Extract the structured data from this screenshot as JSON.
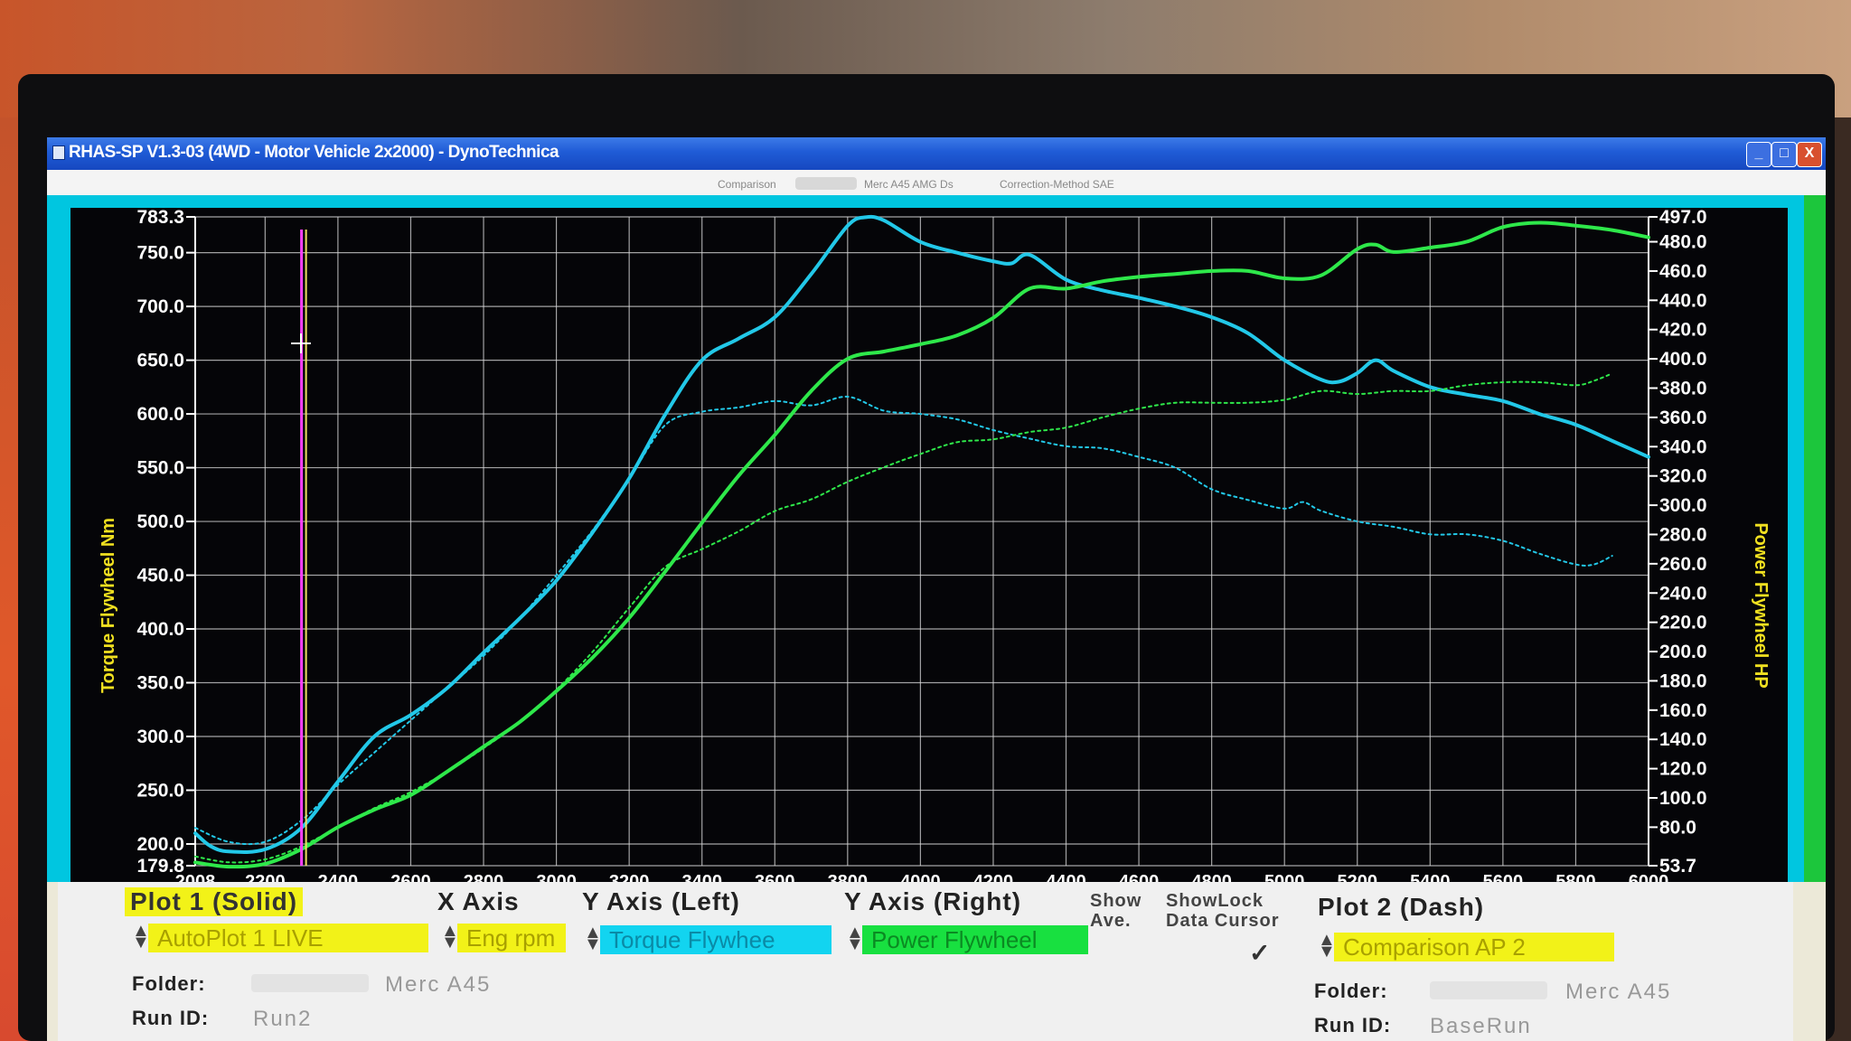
{
  "window": {
    "title": "RHAS-SP V1.3-03  (4WD - Motor Vehicle 2x2000) - DynoTechnica",
    "min": "_",
    "max": "□",
    "close": "X"
  },
  "comparison": {
    "label": "Comparison",
    "vehicle": "Merc A45 AMG Ds",
    "correction": "Correction-Method  SAE"
  },
  "panel": {
    "plot1_header": "Plot 1 (Solid)",
    "plot1_select": "AutoPlot 1 LIVE",
    "xaxis_header": "X Axis",
    "xaxis_select": "Eng rpm",
    "yleft_header": "Y Axis (Left)",
    "yleft_select": "Torque Flywhee",
    "yright_header": "Y Axis (Right)",
    "yright_select": "Power Flywheel",
    "show_ave_1": "Show",
    "show_ave_2": "Ave.",
    "showlock_1": "ShowLock",
    "showlock_2": "Data Cursor",
    "checkmark": "✓",
    "plot2_header": "Plot 2 (Dash)",
    "plot2_select": "Comparison AP 2",
    "folder_label": "Folder:",
    "folder1_value": "Merc A45",
    "runid_label": "Run ID:",
    "runid1_value": "Run2",
    "folder2_value": "Merc A45",
    "runid2_value": "BaseRun"
  },
  "colors": {
    "background": "#050508",
    "grid": "#d8d8d8",
    "torque": "#22c8e8",
    "power": "#2ee84a",
    "axis_label": "#f0e020",
    "cursor_magenta": "#ff40ff",
    "cursor_yellow": "#f0e060",
    "plot1_highlight": "#f2f218",
    "torque_highlight": "#12d4f0",
    "power_highlight": "#18e040"
  },
  "chart_data": {
    "type": "line",
    "xlabel": "",
    "ylabel_left": "Torque Flywheel Nm",
    "ylabel_right": "Power Flywheel HP",
    "xlim": [
      2008,
      6000
    ],
    "ylim_left": [
      179.8,
      783.3
    ],
    "ylim_right": [
      53.7,
      497.0
    ],
    "x_ticks": [
      "2008",
      "2200",
      "2400",
      "2600",
      "2800",
      "3000",
      "3200",
      "3400",
      "3600",
      "3800",
      "4000",
      "4200",
      "4400",
      "4600",
      "4800",
      "5000",
      "5200",
      "5400",
      "5600",
      "5800",
      "6000"
    ],
    "y_left_ticks": [
      179.8,
      200.0,
      250.0,
      300.0,
      350.0,
      400.0,
      450.0,
      500.0,
      550.0,
      600.0,
      650.0,
      700.0,
      750.0,
      783.3
    ],
    "y_right_ticks": [
      53.7,
      80.0,
      100.0,
      120.0,
      140.0,
      160.0,
      180.0,
      200.0,
      220.0,
      240.0,
      260.0,
      280.0,
      300.0,
      320.0,
      340.0,
      360.0,
      380.0,
      400.0,
      420.0,
      440.0,
      460.0,
      480.0,
      497.0
    ],
    "grid": true,
    "cursor_rpm": 2300,
    "series": [
      {
        "axis": "left",
        "style": "solid",
        "x": [
          2008,
          2050,
          2100,
          2200,
          2300,
          2400,
          2500,
          2600,
          2700,
          2800,
          2900,
          3000,
          3100,
          3200,
          3300,
          3400,
          3500,
          3600,
          3700,
          3800,
          3850,
          3900,
          4000,
          4100,
          4200,
          4250,
          4300,
          4400,
          4500,
          4600,
          4700,
          4800,
          4900,
          5000,
          5100,
          5150,
          5200,
          5250,
          5300,
          5400,
          5500,
          5600,
          5700,
          5800,
          5900,
          6000
        ],
        "y": [
          210,
          198,
          193,
          195,
          215,
          258,
          300,
          320,
          345,
          378,
          410,
          445,
          490,
          540,
          600,
          650,
          670,
          690,
          730,
          775,
          783,
          780,
          760,
          750,
          742,
          740,
          748,
          725,
          715,
          708,
          700,
          690,
          675,
          650,
          632,
          630,
          638,
          650,
          640,
          625,
          618,
          612,
          600,
          590,
          575,
          560
        ]
      },
      {
        "axis": "left",
        "style": "dash",
        "x": [
          2008,
          2100,
          2200,
          2300,
          2400,
          2500,
          2600,
          2700,
          2800,
          2900,
          3000,
          3100,
          3200,
          3300,
          3400,
          3500,
          3600,
          3700,
          3800,
          3900,
          4000,
          4100,
          4200,
          4300,
          4400,
          4500,
          4600,
          4700,
          4800,
          4900,
          5000,
          5050,
          5100,
          5200,
          5300,
          5400,
          5500,
          5600,
          5700,
          5800,
          5850,
          5900
        ],
        "y": [
          215,
          202,
          202,
          222,
          255,
          285,
          315,
          345,
          375,
          410,
          450,
          492,
          540,
          590,
          602,
          606,
          612,
          608,
          616,
          603,
          600,
          595,
          585,
          577,
          570,
          568,
          560,
          550,
          530,
          520,
          512,
          518,
          510,
          500,
          495,
          488,
          488,
          482,
          470,
          460,
          460,
          468
        ]
      },
      {
        "axis": "right",
        "style": "solid",
        "x": [
          2008,
          2100,
          2200,
          2300,
          2400,
          2500,
          2600,
          2700,
          2800,
          2900,
          3000,
          3100,
          3200,
          3300,
          3400,
          3500,
          3600,
          3700,
          3800,
          3900,
          4000,
          4100,
          4200,
          4300,
          4400,
          4500,
          4600,
          4700,
          4800,
          4900,
          5000,
          5100,
          5200,
          5250,
          5300,
          5400,
          5500,
          5600,
          5700,
          5800,
          5900,
          6000
        ],
        "y": [
          56,
          53,
          55,
          65,
          80,
          92,
          102,
          118,
          135,
          152,
          173,
          196,
          223,
          255,
          288,
          320,
          348,
          378,
          400,
          405,
          410,
          416,
          428,
          448,
          448,
          453,
          456,
          458,
          460,
          460,
          455,
          457,
          475,
          478,
          473,
          476,
          480,
          490,
          493,
          491,
          488,
          483
        ]
      },
      {
        "axis": "right",
        "style": "dash",
        "x": [
          2008,
          2100,
          2200,
          2300,
          2400,
          2500,
          2600,
          2700,
          2800,
          2900,
          3000,
          3100,
          3200,
          3300,
          3400,
          3500,
          3600,
          3700,
          3800,
          3900,
          4000,
          4100,
          4200,
          4300,
          4400,
          4500,
          4600,
          4700,
          4800,
          4900,
          5000,
          5100,
          5200,
          5300,
          5400,
          5500,
          5600,
          5700,
          5800,
          5850,
          5900
        ],
        "y": [
          60,
          56,
          58,
          67,
          80,
          93,
          104,
          118,
          134,
          152,
          174,
          200,
          230,
          258,
          270,
          282,
          296,
          304,
          316,
          326,
          335,
          343,
          345,
          350,
          353,
          360,
          366,
          370,
          370,
          370,
          372,
          378,
          376,
          378,
          378,
          382,
          384,
          384,
          382,
          385,
          390
        ]
      }
    ]
  }
}
